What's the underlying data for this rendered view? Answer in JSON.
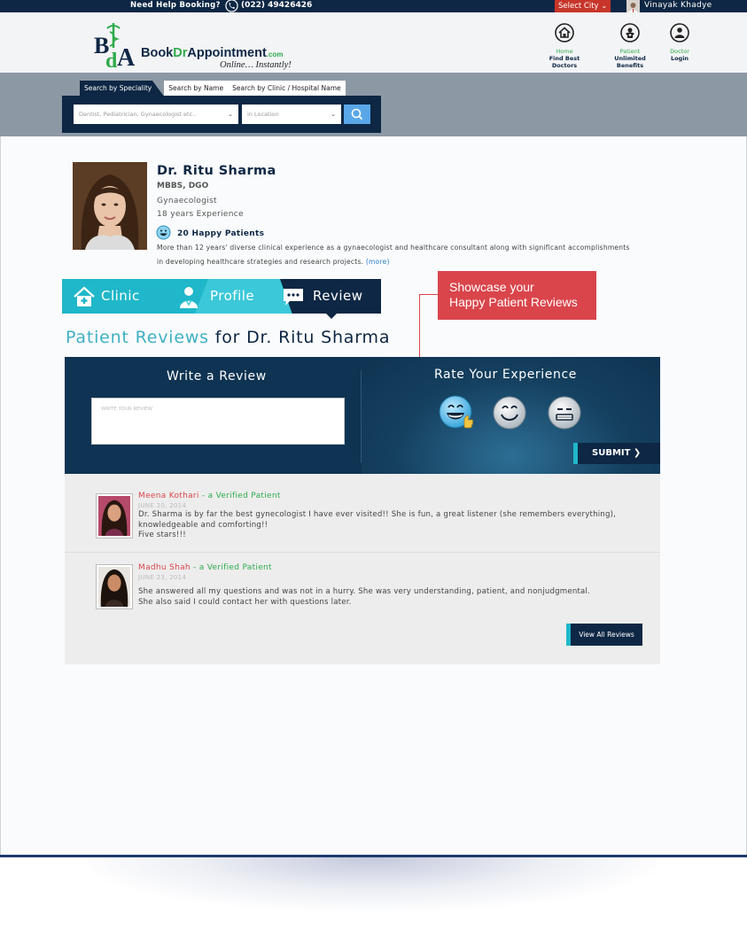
{
  "topbar": {
    "help_label": "Need Help Booking?",
    "phone": "(022) 49426426",
    "city_select": "Select City",
    "user_name": "Vinayak Khadye"
  },
  "brand": {
    "logo_monogram": "BDA",
    "name_part1": "Book",
    "name_part2": "Dr",
    "name_part3": "Appointment",
    "name_suffix": ".com",
    "tagline": "Online… Instantly!"
  },
  "header_nav": [
    {
      "line1": "Home",
      "line2": "Find Best Doctors",
      "icon": "home-icon"
    },
    {
      "line1": "Patient",
      "line2": "Unlimited Benefits",
      "icon": "patient-icon"
    },
    {
      "line1": "Doctor",
      "line2": "Login",
      "icon": "doctor-icon"
    }
  ],
  "search": {
    "tabs": [
      "Search by Speciality",
      "Search by Name",
      "Search by Clinic / Hospital Name"
    ],
    "speciality_placeholder": "Dentist, Pediatrician, Gynaecologist etc..",
    "location_placeholder": "in Location"
  },
  "doctor": {
    "name": "Dr. Ritu Sharma",
    "degree": "MBBS, DGO",
    "speciality": "Gynaecologist",
    "experience": "18 years Experience",
    "happy_patients": "20 Happy Patients",
    "bio_line1": "More than 12 years' diverse clinical experience as a gynaecologist and healthcare consultant along with significant accomplishments",
    "bio_line2": "in developing healthcare strategies and research projects.",
    "more_link": "(more)"
  },
  "profile_tabs": [
    {
      "label": "Clinic",
      "icon": "clinic-icon"
    },
    {
      "label": "Profile",
      "icon": "profile-icon"
    },
    {
      "label": "Review",
      "icon": "review-icon",
      "active": true
    }
  ],
  "callout": {
    "line1": "Showcase your",
    "line2": "Happy Patient Reviews"
  },
  "reviews_heading": {
    "part1": "Patient Reviews",
    "part2": "for Dr. Ritu Sharma"
  },
  "review_form": {
    "write_title": "Write a Review",
    "placeholder": "WRITE YOUR REVIEW",
    "rate_title": "Rate Your Experience",
    "ratings": [
      "very-happy-smiley-icon",
      "happy-smiley-icon",
      "neutral-smiley-icon"
    ],
    "submit_label": "SUBMIT ❯"
  },
  "reviews": [
    {
      "name": "Meena Kothari",
      "verified": "- a Verified Patient",
      "date": "JUNE 20, 2014",
      "line1": "Dr. Sharma is by far the best gynecologist I have ever visited!! She is fun, a great listener (she remembers everything),",
      "line2": "knowledgeable and comforting!!",
      "line3": "Five stars!!!"
    },
    {
      "name": "Madhu Shah",
      "verified": "- a Verified Patient",
      "date": "JUNE 23, 2014",
      "line1": "She answered all my questions and was not in a hurry. She was very understanding, patient, and nonjudgmental.",
      "line2": "She also said I could contact her with questions later."
    }
  ],
  "view_all_label": "View All Reviews",
  "colors": {
    "navy": "#0d2744",
    "teal": "#1fb7c9",
    "accent_red": "#d9454b",
    "green": "#2eab4a"
  }
}
